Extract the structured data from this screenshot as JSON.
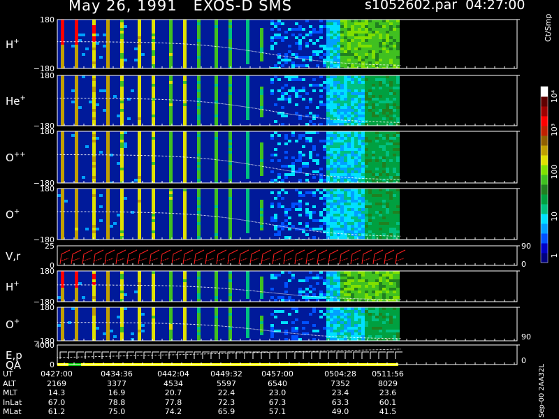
{
  "header": {
    "title_left": "May 26, 1991   EXOS-D SMS",
    "title_right": "s1052602.par  04:27:00"
  },
  "colorbar": {
    "title": "Ct/Smp",
    "tick_labels": [
      "1",
      "10",
      "100",
      "10³",
      "10⁴"
    ],
    "colors": [
      "#000080",
      "#0000c8",
      "#0050ff",
      "#00a0ff",
      "#00e0ff",
      "#00c080",
      "#00a040",
      "#208020",
      "#40c020",
      "#80e000",
      "#e0e000",
      "#c0a000",
      "#906000",
      "#c02000",
      "#ff0000",
      "#a00000",
      "#600000",
      "#ffffff"
    ]
  },
  "footer": {
    "vertical_text": "Sep-00  2AA32L"
  },
  "orbit_table": {
    "rows": [
      {
        "label": "UT",
        "values": [
          "0427:00",
          "0434:36",
          "0442:04",
          "0449:32",
          "0457:00",
          "0504:28",
          "0511:56"
        ]
      },
      {
        "label": "ALT",
        "values": [
          "2169",
          "3377",
          "4534",
          "5597",
          "6540",
          "7352",
          "8029"
        ]
      },
      {
        "label": "MLT",
        "values": [
          "14.3",
          "16.9",
          "20.7",
          "22.4",
          "23.0",
          "23.4",
          "23.6"
        ]
      },
      {
        "label": "InLat",
        "values": [
          "67.0",
          "78.8",
          "77.8",
          "72.3",
          "67.3",
          "63.3",
          "60.1"
        ]
      },
      {
        "label": "MLat",
        "values": [
          "61.2",
          "75.0",
          "74.2",
          "65.9",
          "57.1",
          "49.0",
          "41.5"
        ]
      }
    ]
  },
  "chart_data": [
    {
      "type": "heatmap",
      "label": "H",
      "label_sup": "+",
      "ylim": [
        -180,
        180
      ],
      "y_tick_labels": [
        "180",
        "−180"
      ]
    },
    {
      "type": "heatmap",
      "label": "He",
      "label_sup": "+",
      "ylim": [
        -180,
        180
      ],
      "y_tick_labels": [
        "180",
        "−180"
      ]
    },
    {
      "type": "heatmap",
      "label": "O",
      "label_sup": "++",
      "ylim": [
        -180,
        180
      ],
      "y_tick_labels": [
        "180",
        "−180"
      ]
    },
    {
      "type": "heatmap",
      "label": "O",
      "label_sup": "+",
      "ylim": [
        -180,
        180
      ],
      "y_tick_labels": [
        "180",
        "−180"
      ]
    },
    {
      "type": "line",
      "label": "V,r",
      "label_sup": "",
      "ylim": [
        0,
        25
      ],
      "y_tick_labels": [
        "25",
        "0"
      ],
      "y2_tick_labels": [
        "90",
        "0"
      ],
      "series_color": "#ff2020"
    },
    {
      "type": "heatmap",
      "label": "H",
      "label_sup": "+",
      "ylim": [
        -180,
        180
      ],
      "y_tick_labels": [
        "180",
        "−180"
      ]
    },
    {
      "type": "heatmap",
      "label": "O",
      "label_sup": "+",
      "ylim": [
        -180,
        180
      ],
      "y_tick_labels": [
        "180",
        "−180"
      ],
      "y2_tick_labels": [
        "90"
      ]
    },
    {
      "type": "line",
      "label": "E,p",
      "label2": "QA",
      "label_sup": "",
      "ylim": [
        0,
        4000
      ],
      "y_tick_labels": [
        "4000",
        "0"
      ],
      "y2_tick_labels": [
        "0"
      ],
      "series_color": "#ffffff",
      "qa_colors": [
        "#ffff00",
        "#00c000"
      ]
    }
  ]
}
